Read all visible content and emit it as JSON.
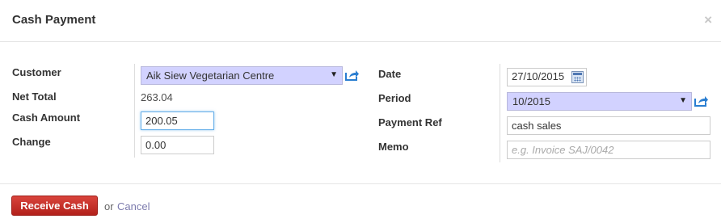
{
  "dialog": {
    "title": "Cash Payment",
    "close_glyph": "×"
  },
  "left": {
    "customer_label": "Customer",
    "customer_value": "Aik Siew Vegetarian Centre",
    "net_total_label": "Net Total",
    "net_total_value": "263.04",
    "cash_amount_label": "Cash Amount",
    "cash_amount_value": "200.05",
    "change_label": "Change",
    "change_value": "0.00"
  },
  "right": {
    "date_label": "Date",
    "date_value": "27/10/2015",
    "period_label": "Period",
    "period_value": "10/2015",
    "payment_ref_label": "Payment Ref",
    "payment_ref_value": "cash sales",
    "memo_label": "Memo",
    "memo_placeholder": "e.g. Invoice SAJ/0042"
  },
  "footer": {
    "receive_label": "Receive Cash",
    "or_text": "or",
    "cancel_label": "Cancel"
  },
  "colors": {
    "select_bg": "#d2d2ff",
    "primary_button": "#c1302a",
    "link": "#7c7bad",
    "external_icon": "#2a7ed1"
  }
}
